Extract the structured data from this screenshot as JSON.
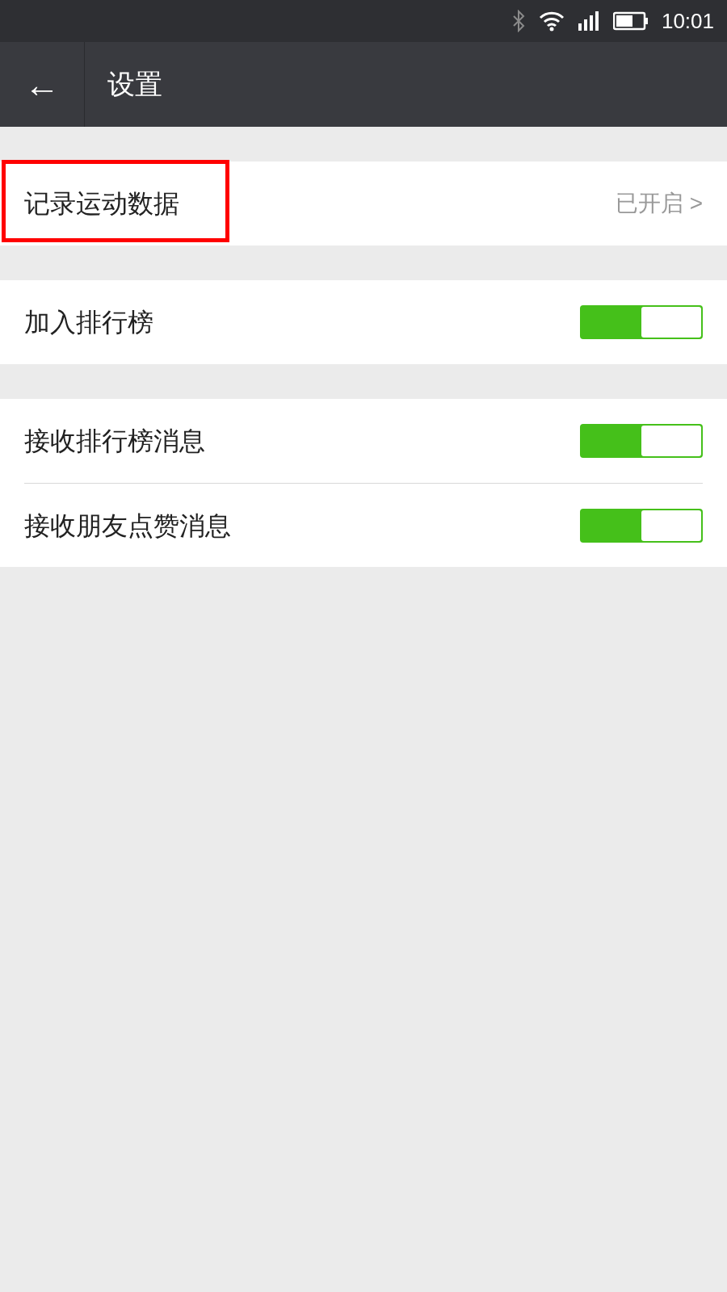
{
  "status_bar": {
    "time": "10:01"
  },
  "header": {
    "back": "←",
    "title": "设置"
  },
  "groups": [
    {
      "items": [
        {
          "kind": "link",
          "label": "记录运动数据",
          "value": "已开启 >",
          "highlighted": true
        }
      ]
    },
    {
      "items": [
        {
          "kind": "toggle",
          "label": "加入排行榜",
          "on": true,
          "highlighted": false
        }
      ]
    },
    {
      "items": [
        {
          "kind": "toggle",
          "label": "接收排行榜消息",
          "on": true,
          "highlighted": false
        },
        {
          "kind": "toggle",
          "label": "接收朋友点赞消息",
          "on": true,
          "highlighted": false
        }
      ]
    }
  ]
}
